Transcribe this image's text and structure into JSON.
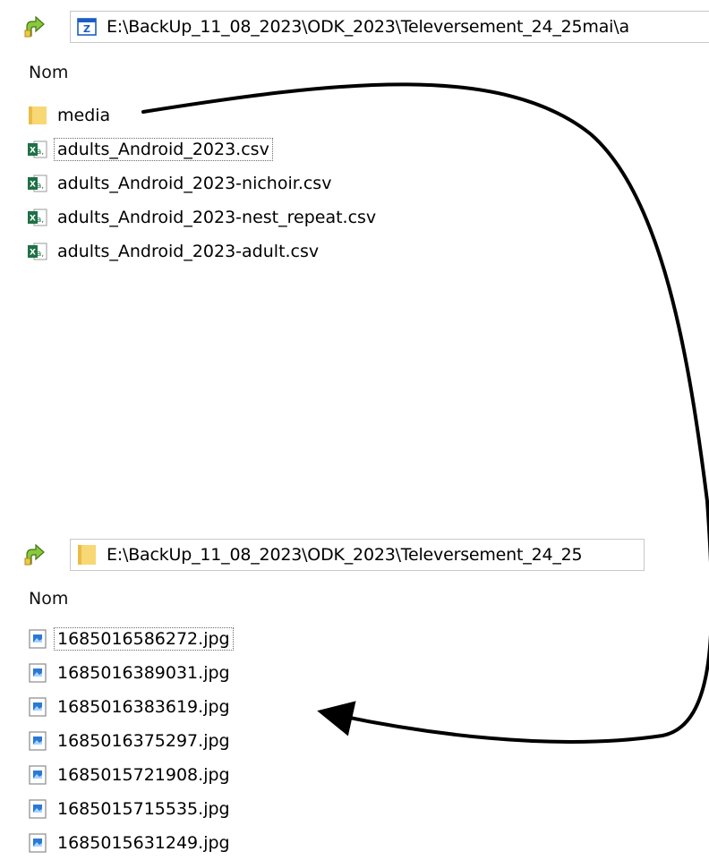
{
  "top_pane": {
    "address": "E:\\BackUp_11_08_2023\\ODK_2023\\Televersement_24_25mai\\a",
    "column_header": "Nom",
    "items": [
      {
        "name": "media",
        "type": "folder",
        "icon": "folder-icon"
      },
      {
        "name": "adults_Android_2023.csv",
        "type": "csv",
        "icon": "excel-csv-icon",
        "focused": true
      },
      {
        "name": "adults_Android_2023-nichoir.csv",
        "type": "csv",
        "icon": "excel-csv-icon"
      },
      {
        "name": "adults_Android_2023-nest_repeat.csv",
        "type": "csv",
        "icon": "excel-csv-icon"
      },
      {
        "name": "adults_Android_2023-adult.csv",
        "type": "csv",
        "icon": "excel-csv-icon"
      }
    ]
  },
  "bottom_pane": {
    "address": "E:\\BackUp_11_08_2023\\ODK_2023\\Televersement_24_25",
    "column_header": "Nom",
    "items": [
      {
        "name": "1685016586272.jpg",
        "type": "jpg",
        "icon": "image-file-icon",
        "focused": true
      },
      {
        "name": "1685016389031.jpg",
        "type": "jpg",
        "icon": "image-file-icon"
      },
      {
        "name": "1685016383619.jpg",
        "type": "jpg",
        "icon": "image-file-icon"
      },
      {
        "name": "1685016375297.jpg",
        "type": "jpg",
        "icon": "image-file-icon"
      },
      {
        "name": "1685015721908.jpg",
        "type": "jpg",
        "icon": "image-file-icon"
      },
      {
        "name": "1685015715535.jpg",
        "type": "jpg",
        "icon": "image-file-icon"
      },
      {
        "name": "1685015631249.jpg",
        "type": "jpg",
        "icon": "image-file-icon"
      }
    ]
  },
  "colors": {
    "folder": "#f8d775",
    "excel_green": "#1e7145",
    "image_blue": "#2b79d4",
    "arrow": "#000000"
  }
}
